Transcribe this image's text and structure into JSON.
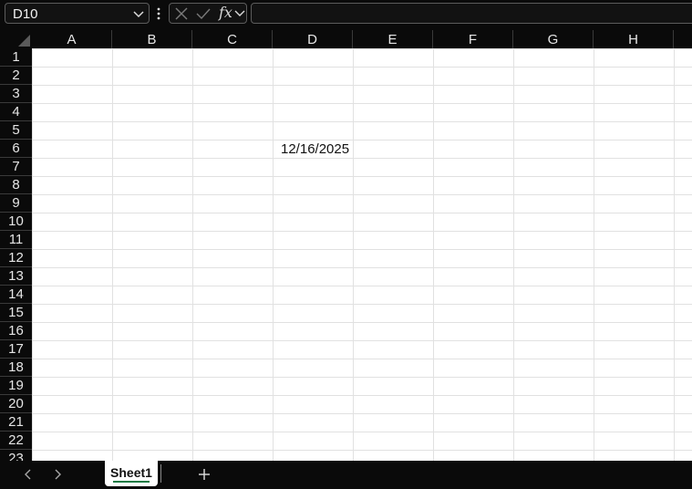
{
  "formula_bar": {
    "name_box": "D10",
    "fx_label": "fx",
    "formula": ""
  },
  "columns": [
    "A",
    "B",
    "C",
    "D",
    "E",
    "F",
    "G",
    "H"
  ],
  "rows": [
    "1",
    "2",
    "3",
    "4",
    "5",
    "6",
    "7",
    "8",
    "9",
    "10",
    "11",
    "12",
    "13",
    "14",
    "15",
    "16",
    "17",
    "18",
    "19",
    "20",
    "21",
    "22",
    "23"
  ],
  "cells": {
    "D6": "12/16/2025"
  },
  "sheets": [
    {
      "label": "Sheet1",
      "active": true
    }
  ],
  "icons": {
    "name_box_dropdown": "chevron-down-icon",
    "more": "kebab-icon",
    "cancel": "close-icon",
    "enter": "check-icon",
    "fx_dropdown": "chevron-down-icon",
    "prev_sheet": "chevron-left-icon",
    "next_sheet": "chevron-right-icon",
    "add_sheet": "plus-icon"
  },
  "colors": {
    "app_bg": "#0a0a0a",
    "grid_bg": "#ffffff",
    "gridline": "#e1e1e1",
    "active_tab_underline": "#137a43"
  }
}
